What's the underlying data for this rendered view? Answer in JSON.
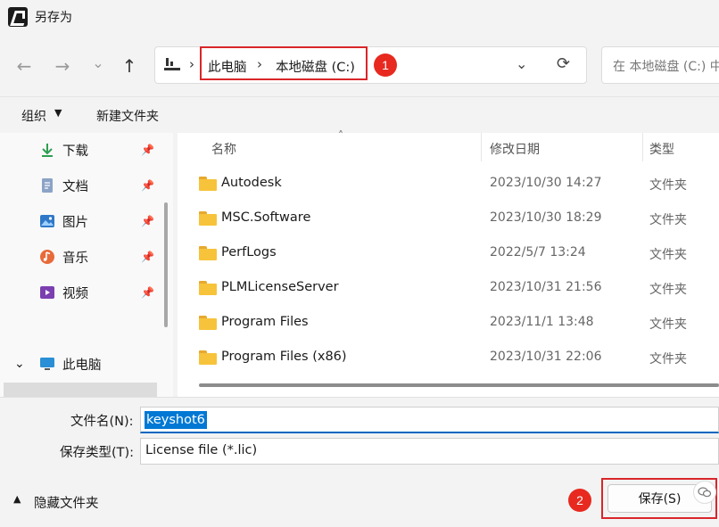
{
  "window": {
    "title": "另存为"
  },
  "nav": {
    "back_icon": "←",
    "forward_icon": "→",
    "recent_icon": "⌄",
    "up_icon": "↑",
    "address_segments": [
      "此电脑",
      "本地磁盘 (C:)"
    ],
    "separator": "›",
    "dropdown_icon": "⌄",
    "refresh_icon": "⟳",
    "search_placeholder": "在 本地磁盘 (C:) 中搜索"
  },
  "annotations": {
    "badge1": "1",
    "badge2": "2",
    "accent_color": "#d9262a"
  },
  "toolbar": {
    "organize": "组织",
    "organize_caret": "▼",
    "new_folder": "新建文件夹"
  },
  "sidebar": {
    "pin_icon": "📌",
    "items": [
      {
        "label": "下载",
        "icon": "download-icon"
      },
      {
        "label": "文档",
        "icon": "document-icon"
      },
      {
        "label": "图片",
        "icon": "picture-icon"
      },
      {
        "label": "音乐",
        "icon": "music-icon"
      },
      {
        "label": "视频",
        "icon": "video-icon"
      }
    ],
    "this_pc": {
      "label": "此电脑",
      "caret": "⌄"
    }
  },
  "filelist": {
    "columns": {
      "name": "名称",
      "date": "修改日期",
      "type": "类型"
    },
    "sort_arrow": "˄",
    "rows": [
      {
        "name": "Autodesk",
        "date": "2023/10/30 14:27",
        "type": "文件夹"
      },
      {
        "name": "MSC.Software",
        "date": "2023/10/30 18:29",
        "type": "文件夹"
      },
      {
        "name": "PerfLogs",
        "date": "2022/5/7 13:24",
        "type": "文件夹"
      },
      {
        "name": "PLMLicenseServer",
        "date": "2023/10/31 21:56",
        "type": "文件夹"
      },
      {
        "name": "Program Files",
        "date": "2023/11/1 13:48",
        "type": "文件夹"
      },
      {
        "name": "Program Files (x86)",
        "date": "2023/10/31 22:06",
        "type": "文件夹"
      }
    ]
  },
  "form": {
    "filename_label": "文件名(N):",
    "filename_value": "keyshot6",
    "filetype_label": "保存类型(T):",
    "filetype_value": "License file (*.lic)"
  },
  "footer": {
    "hide_caret": "▲",
    "hide_folders": "隐藏文件夹",
    "save_button": "保存(S)",
    "watermark_icon": "wechat-icon"
  }
}
